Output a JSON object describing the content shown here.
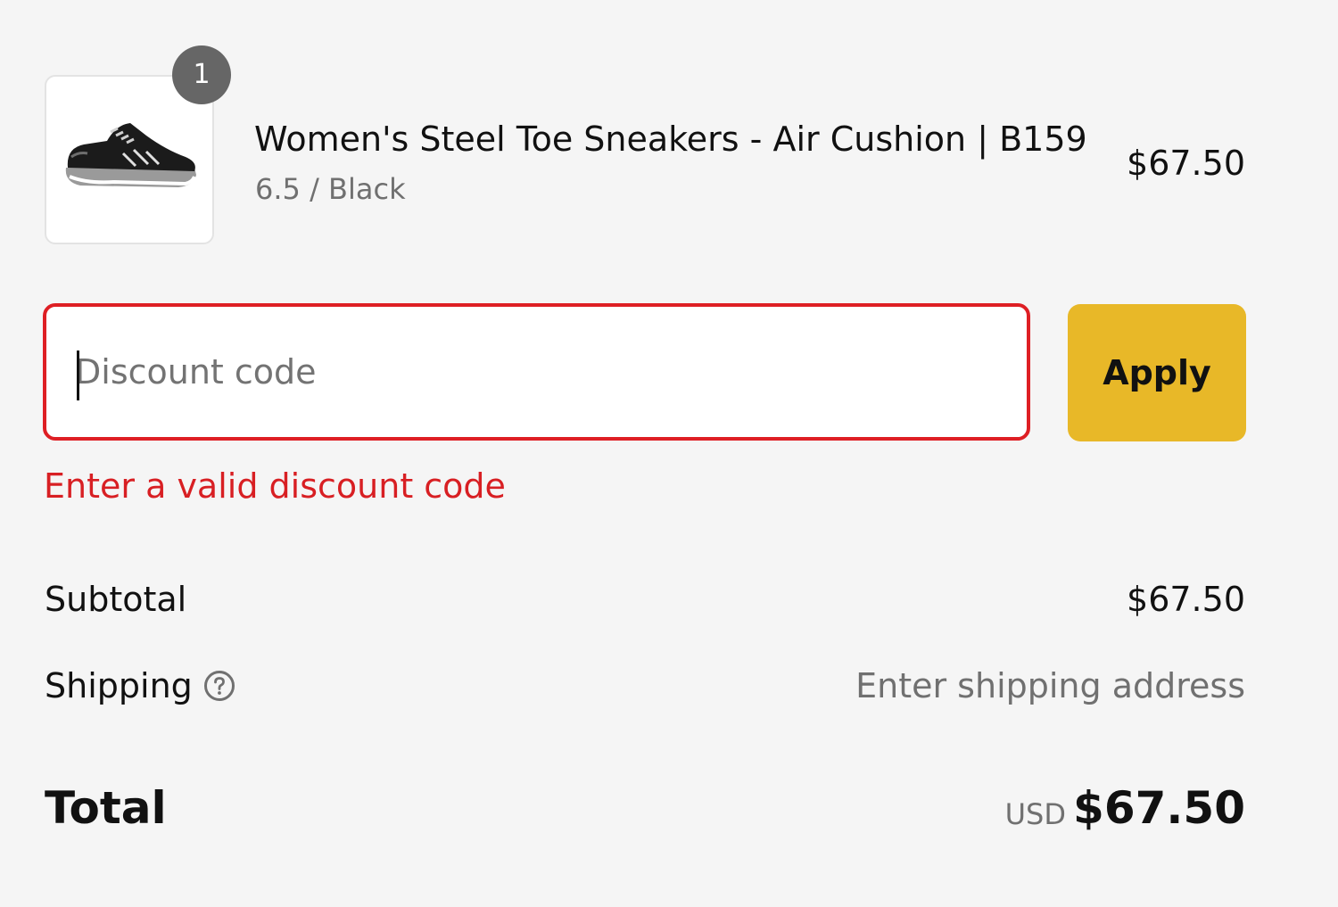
{
  "line_item": {
    "quantity": "1",
    "title": "Women's Steel Toe Sneakers - Air Cushion | B159",
    "variant": "6.5 / Black",
    "price": "$67.50",
    "image_icon": "sneaker-image"
  },
  "discount": {
    "placeholder": "Discount code",
    "value": "",
    "apply_label": "Apply",
    "error": "Enter a valid discount code",
    "error_color": "#de1f24",
    "button_color": "#e8b828"
  },
  "summary": {
    "subtotal_label": "Subtotal",
    "subtotal_value": "$67.50",
    "shipping_label": "Shipping",
    "shipping_help_icon": "question-circle-icon",
    "shipping_value": "Enter shipping address",
    "total_label": "Total",
    "total_currency": "USD",
    "total_value": "$67.50"
  }
}
